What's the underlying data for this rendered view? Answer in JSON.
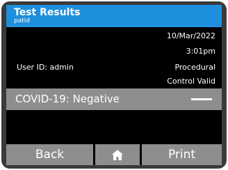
{
  "header": {
    "title": "Test Results",
    "subtitle": "patid"
  },
  "info": {
    "date": "10/Mar/2022",
    "time": "3:01pm",
    "user_id": "User ID: admin",
    "control_line1": "Procedural",
    "control_line2": "Control Valid"
  },
  "result": {
    "text": "COVID-19: Negative",
    "indicator": "minus-icon"
  },
  "buttons": {
    "back_label": "Back",
    "home_icon": "home-icon",
    "print_label": "Print"
  },
  "colors": {
    "header": "#1e8fdc",
    "screen_bg": "#000000",
    "button_bg": "#8e8e8e",
    "text": "#ffffff"
  }
}
